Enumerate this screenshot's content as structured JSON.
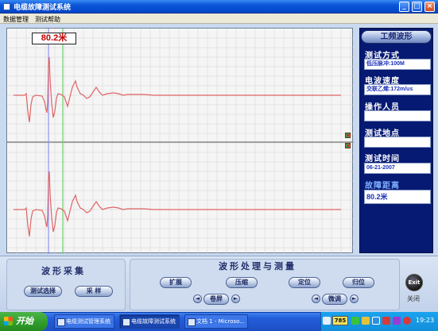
{
  "window": {
    "title": "电缆故障测试系统",
    "controls": {
      "minimize": "_",
      "maximize": "□",
      "close": "×"
    }
  },
  "menu": {
    "items": [
      "数据管理",
      "测试帮助"
    ]
  },
  "plot": {
    "distance_label": "80.2米",
    "colors": {
      "trace": "#e06464",
      "grid": "#d4d4d4",
      "cursor_blue": "#8f8ff2",
      "cursor_green": "#6fd06f",
      "divider": "#888888"
    }
  },
  "right_panel": {
    "freeze_button": "工频波形",
    "test_method_label": "测试方式",
    "test_method_value": "低压脉冲:100M",
    "wave_speed_label": "电波速度",
    "wave_speed_value": "交联乙烯:172m/us",
    "operator_label": "操作人员",
    "operator_value": "",
    "location_label": "测试地点",
    "location_value": "",
    "time_label": "测试时间",
    "time_value": "06-21-2007",
    "fault_distance_label": "故障距离",
    "fault_distance_value": "80.2米"
  },
  "controls": {
    "acquire_group_title": "波形采集",
    "test_select_button": "测试选择",
    "sample_button": "采 样",
    "process_group_title": "波形处理与测量",
    "expand_button": "扩展",
    "compress_button": "压缩",
    "locate_button": "定位",
    "reset_button": "归位",
    "roll_button": "卷屏",
    "fine_tune_button": "微调",
    "left_arrow": "◄",
    "right_arrow": "►",
    "exit_button": "Exit",
    "exit_label": "关闭"
  },
  "taskbar": {
    "start": "开始",
    "tasks": [
      "电缆测试管理系统",
      "电缆故障测试系统",
      "文档 1 - Microso..."
    ],
    "tray_badge": "785",
    "clock": "19:23"
  }
}
